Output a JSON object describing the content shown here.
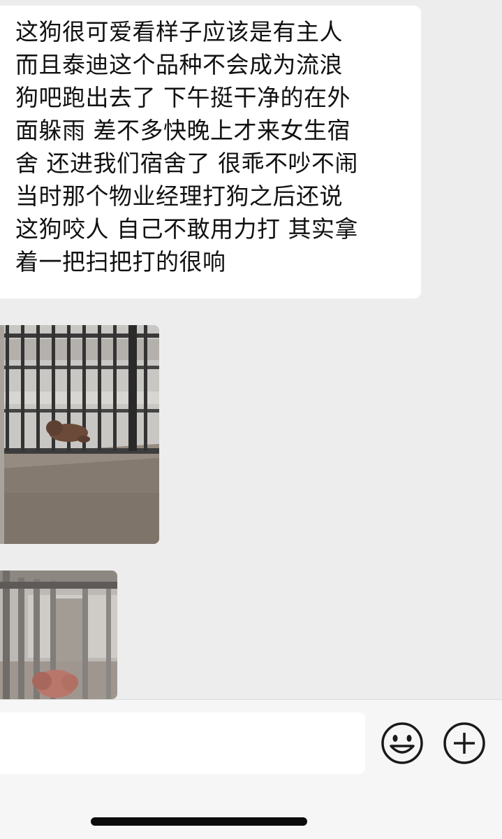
{
  "chat": {
    "message_lines": [
      "这狗很可爱看样子应该是有主人",
      "而且泰迪这个品种不会成为流浪",
      "狗吧跑出去了 下午挺干净的在外",
      "面躲雨 差不多快晚上才来女生宿",
      "舍 还进我们宿舍了 很乖不吵不闹",
      "当时那个物业经理打狗之后还说",
      "这狗咬人 自己不敢用力打 其实拿",
      "着一把扫把打的很响"
    ]
  },
  "input_bar": {
    "message_value": "",
    "emoji_icon": "smiley-face-icon",
    "plus_icon": "plus-circle-icon"
  },
  "colors": {
    "background": "#ededed",
    "bubble": "#ffffff",
    "text": "#111111",
    "input_bar": "#f6f6f6",
    "home_indicator": "#0b0b0b"
  }
}
